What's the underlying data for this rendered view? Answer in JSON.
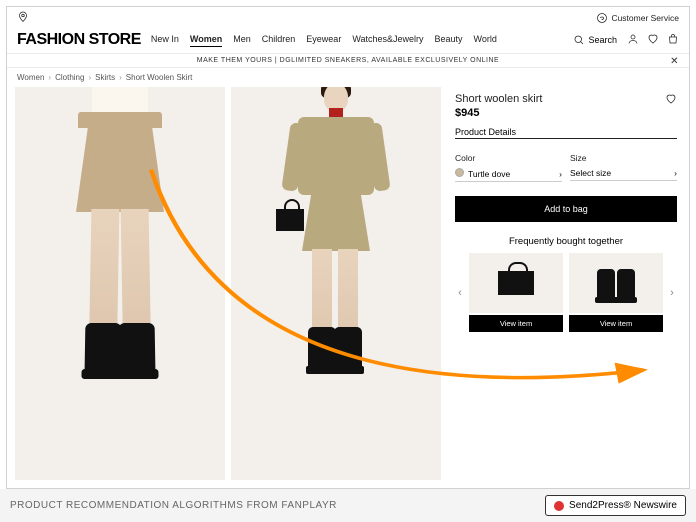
{
  "topbar": {
    "customer_service": "Customer Service"
  },
  "header": {
    "logo": "FASHION STORE",
    "nav": [
      "New In",
      "Women",
      "Men",
      "Children",
      "Eyewear",
      "Watches&Jewelry",
      "Beauty",
      "World"
    ],
    "active_nav_index": 1,
    "search_label": "Search"
  },
  "promo": {
    "text": "MAKE THEM YOURS | DGLIMITED SNEAKERS, AVAILABLE EXCLUSIVELY ONLINE"
  },
  "breadcrumb": [
    "Women",
    "Clothing",
    "Skirts",
    "Short Woolen Skirt"
  ],
  "product": {
    "title": "Short woolen skirt",
    "price": "$945",
    "details_label": "Product Details",
    "options": {
      "color": {
        "label": "Color",
        "value": "Turtle dove"
      },
      "size": {
        "label": "Size",
        "value": "Select size"
      }
    },
    "add_label": "Add to bag"
  },
  "fbt": {
    "title": "Frequently bought together",
    "items": [
      {
        "name": "handbag",
        "cta": "View item"
      },
      {
        "name": "boots",
        "cta": "View item"
      }
    ]
  },
  "caption": {
    "text": "PRODUCT RECOMMENDATION ALGORITHMS FROM FANPLAYR",
    "newswire_label": "Send2Press® Newswire"
  }
}
